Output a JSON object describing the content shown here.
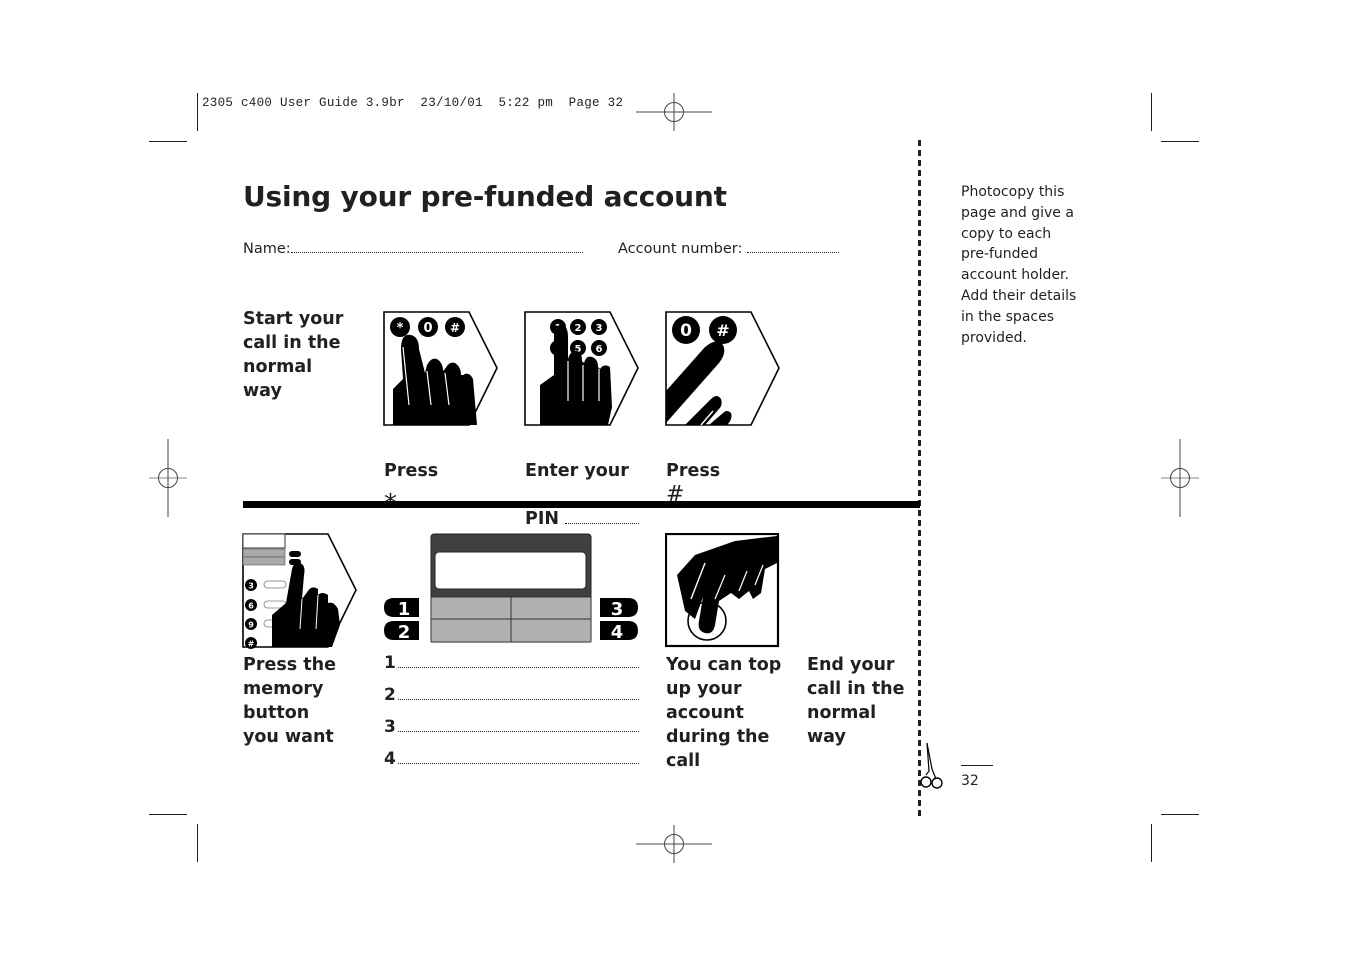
{
  "print_slug": "2305 c400 User Guide 3.9br  23/10/01  5:22 pm  Page 32",
  "title": "Using your pre-funded account",
  "fields": {
    "name_label": "Name:",
    "account_label": "Account number:"
  },
  "sidebar_note": "Photocopy this\npage and give a\ncopy to each\npre-funded\naccount holder.\nAdd their details\nin the spaces\nprovided.",
  "steps_top": {
    "intro": "Start your\ncall in the\nnormal\nway",
    "step1": {
      "label": "Press",
      "symbol": "⁎"
    },
    "step2": {
      "label_line1": "Enter your",
      "label_line2": "PIN"
    },
    "step3": {
      "label": "Press",
      "symbol": "#"
    },
    "keypad1": [
      "*",
      "0",
      "#"
    ],
    "keypad2": [
      "1",
      "2",
      "3",
      "5",
      "6"
    ],
    "keypad3": [
      "0",
      "#"
    ]
  },
  "steps_bottom": {
    "memory": "Press the\nmemory\nbutton\nyou want",
    "memory_keys": [
      "3",
      "6",
      "9",
      "#"
    ],
    "memory_buttons": [
      "1",
      "2",
      "3",
      "4"
    ],
    "memory_list": [
      "1",
      "2",
      "3",
      "4"
    ],
    "topup": "You can top\nup your\naccount\nduring the\ncall",
    "end": "End your\ncall in the\nnormal\nway"
  },
  "page_number": "32"
}
